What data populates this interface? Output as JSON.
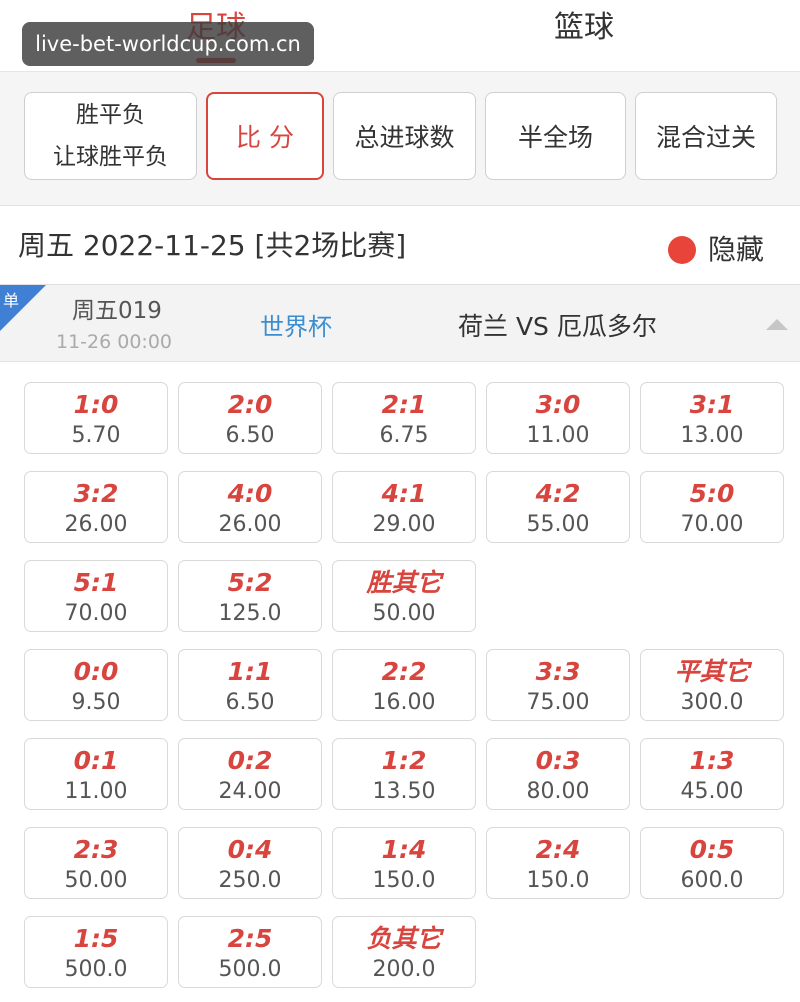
{
  "sport_tabs": {
    "soccer": "足球",
    "basketball": "篮球"
  },
  "watermark": "live-bet-worldcup.com.cn",
  "play_tabs": {
    "wdl_line1": "胜平负",
    "wdl_line2": "让球胜平负",
    "score": "比 分",
    "total_goals": "总进球数",
    "half_full": "半全场",
    "mixed": "混合过关"
  },
  "date_header": {
    "text": "周五 2022-11-25 [共2场比赛]",
    "hide_label": "隐藏"
  },
  "match": {
    "single_badge": "单",
    "number": "周五019",
    "time": "11-26 00:00",
    "league": "世界杯",
    "teams": "荷兰 VS 厄瓜多尔"
  },
  "odds": [
    {
      "score": "1:0",
      "value": "5.70"
    },
    {
      "score": "2:0",
      "value": "6.50"
    },
    {
      "score": "2:1",
      "value": "6.75"
    },
    {
      "score": "3:0",
      "value": "11.00"
    },
    {
      "score": "3:1",
      "value": "13.00"
    },
    {
      "score": "3:2",
      "value": "26.00"
    },
    {
      "score": "4:0",
      "value": "26.00"
    },
    {
      "score": "4:1",
      "value": "29.00"
    },
    {
      "score": "4:2",
      "value": "55.00"
    },
    {
      "score": "5:0",
      "value": "70.00"
    },
    {
      "score": "5:1",
      "value": "70.00"
    },
    {
      "score": "5:2",
      "value": "125.0"
    },
    {
      "score": "胜其它",
      "value": "50.00"
    },
    {
      "score": "0:0",
      "value": "9.50"
    },
    {
      "score": "1:1",
      "value": "6.50"
    },
    {
      "score": "2:2",
      "value": "16.00"
    },
    {
      "score": "3:3",
      "value": "75.00"
    },
    {
      "score": "平其它",
      "value": "300.0"
    },
    {
      "score": "0:1",
      "value": "11.00"
    },
    {
      "score": "0:2",
      "value": "24.00"
    },
    {
      "score": "1:2",
      "value": "13.50"
    },
    {
      "score": "0:3",
      "value": "80.00"
    },
    {
      "score": "1:3",
      "value": "45.00"
    },
    {
      "score": "2:3",
      "value": "50.00"
    },
    {
      "score": "0:4",
      "value": "250.0"
    },
    {
      "score": "1:4",
      "value": "150.0"
    },
    {
      "score": "2:4",
      "value": "150.0"
    },
    {
      "score": "0:5",
      "value": "600.0"
    },
    {
      "score": "1:5",
      "value": "500.0"
    },
    {
      "score": "2:5",
      "value": "500.0"
    },
    {
      "score": "负其它",
      "value": "200.0"
    }
  ],
  "colors": {
    "accent": "#d8453f",
    "league": "#3d8ed0",
    "badge": "#3f7fd4",
    "hide_dot": "#e8443a"
  }
}
